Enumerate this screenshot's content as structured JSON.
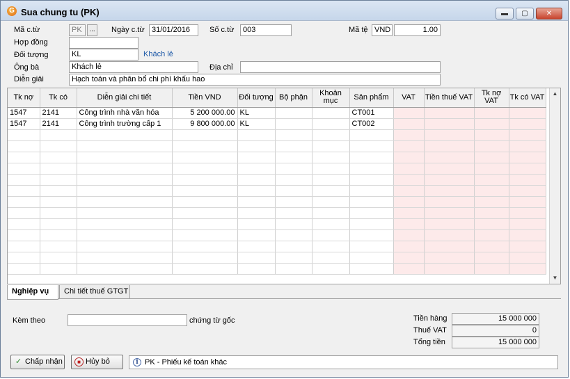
{
  "window": {
    "title": "Sua chung tu (PK)",
    "min_glyph": "▬",
    "max_glyph": "▢",
    "close_glyph": "✕"
  },
  "header": {
    "ma_ct_label": "Mã c.từ",
    "ma_ct_value": "PK",
    "ma_ct_btn": "...",
    "ngay_ct_label": "Ngày c.từ",
    "ngay_ct_value": "31/01/2016",
    "so_ct_label": "Số c.từ",
    "so_ct_value": "003",
    "ma_tte_label": "Mã tệ",
    "ma_tte_value": "VND",
    "ty_gia_value": "1.00",
    "hop_dong_label": "Hợp đồng",
    "hop_dong_value": "",
    "doi_tuong_label": "Đối tượng",
    "doi_tuong_value": "KL",
    "doi_tuong_name": "Khách lẻ",
    "ong_ba_label": "Ông bà",
    "ong_ba_value": "Khách lẻ",
    "dia_chi_label": "Địa chỉ",
    "dia_chi_value": "",
    "dien_giai_label": "Diễn giải",
    "dien_giai_value": "Hạch toán và phân bổ chi phí khấu hao"
  },
  "grid": {
    "columns": [
      "Tk nợ",
      "Tk có",
      "Diễn giải chi tiết",
      "Tiền VND",
      "Đối tượng",
      "Bộ phận",
      "Khoản mục",
      "Sản phẩm",
      "VAT",
      "Tiền thuế VAT",
      "Tk nợ VAT",
      "Tk có VAT"
    ],
    "rows": [
      [
        "1547",
        "2141",
        "Công trình nhà văn hóa",
        "5 200 000.00",
        "KL",
        "",
        "",
        "CT001",
        "",
        "",
        "",
        ""
      ],
      [
        "1547",
        "2141",
        "Công trình trường cấp 1",
        "9 800 000.00",
        "KL",
        "",
        "",
        "CT002",
        "",
        "",
        "",
        ""
      ]
    ],
    "scroll_up": "▲",
    "scroll_down": "▼"
  },
  "tabs": {
    "tab1": "Nghiệp vụ",
    "tab2": "Chi tiết thuế GTGT"
  },
  "footer": {
    "kem_theo_label": "Kèm theo",
    "kem_theo_value": "",
    "chung_tu_goc_label": "chứng từ gốc",
    "tien_hang_label": "Tiền hàng",
    "tien_hang_value": "15 000 000",
    "thue_vat_label": "Thuế VAT",
    "thue_vat_value": "0",
    "tong_tien_label": "Tổng tiền",
    "tong_tien_value": "15 000 000"
  },
  "buttons": {
    "accept_label": "Chấp nhận",
    "cancel_label": "Hủy bỏ"
  },
  "status": {
    "text": "PK - Phiếu kế toán khác",
    "info_glyph": "i"
  },
  "colors": {
    "vat_columns_bg": "#fdeaea",
    "link": "#1e5aa8"
  }
}
